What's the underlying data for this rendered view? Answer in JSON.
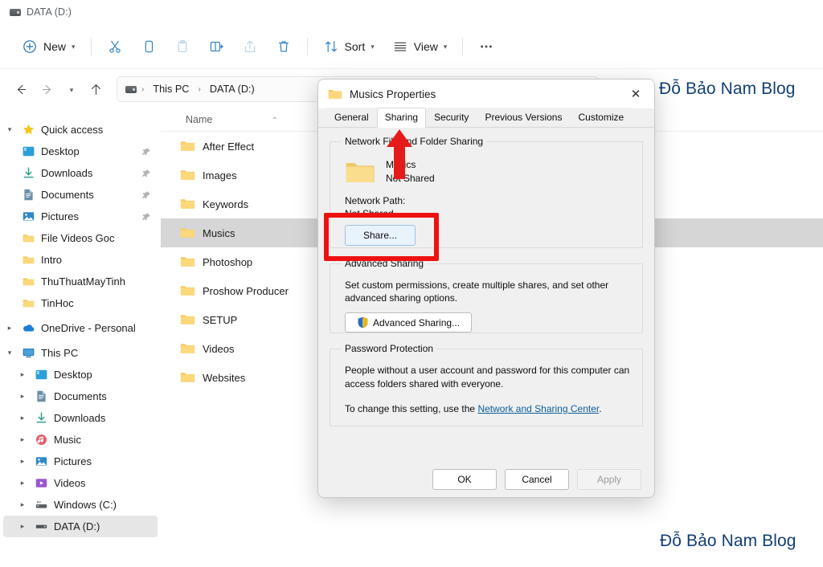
{
  "window": {
    "title": "DATA (D:)",
    "drive_icon": "drive-icon"
  },
  "toolbar": {
    "new_label": "New",
    "sort_label": "Sort",
    "view_label": "View",
    "more_label": "•••",
    "icons": {
      "new": "plus-circle-icon",
      "cut": "scissors-icon",
      "copy": "copy-icon",
      "paste": "paste-icon",
      "rename": "rename-icon",
      "share": "share-icon",
      "delete": "trash-icon",
      "sort": "sort-arrows-icon",
      "view": "view-lines-icon",
      "more": "ellipsis-icon"
    }
  },
  "address_bar": {
    "back_icon": "arrow-left-icon",
    "forward_icon": "arrow-right-icon",
    "recent_icon": "chevron-down-icon",
    "up_icon": "arrow-up-icon",
    "crumbs": [
      "This PC",
      "DATA (D:)"
    ],
    "separator": "›"
  },
  "sidebar": {
    "groups": [
      {
        "label": "Quick access",
        "icon": "star-icon",
        "expander": "chevron-down",
        "items": [
          {
            "label": "Desktop",
            "icon": "desktop-icon",
            "pinned": true
          },
          {
            "label": "Downloads",
            "icon": "download-icon",
            "pinned": true
          },
          {
            "label": "Documents",
            "icon": "document-icon",
            "pinned": true
          },
          {
            "label": "Pictures",
            "icon": "pictures-icon",
            "pinned": true
          },
          {
            "label": "File Videos Goc",
            "icon": "folder-icon",
            "pinned": false
          },
          {
            "label": "Intro",
            "icon": "folder-icon",
            "pinned": false
          },
          {
            "label": "ThuThuatMayTinh",
            "icon": "folder-icon",
            "pinned": false
          },
          {
            "label": "TinHoc",
            "icon": "folder-icon",
            "pinned": false
          }
        ]
      },
      {
        "label": "OneDrive - Personal",
        "icon": "cloud-icon",
        "expander": "chevron-right",
        "items": []
      },
      {
        "label": "This PC",
        "icon": "pc-icon",
        "expander": "chevron-down",
        "items": [
          {
            "label": "Desktop",
            "icon": "desktop-icon",
            "expander": "chevron-right"
          },
          {
            "label": "Documents",
            "icon": "document-icon",
            "expander": "chevron-right"
          },
          {
            "label": "Downloads",
            "icon": "download-icon",
            "expander": "chevron-right"
          },
          {
            "label": "Music",
            "icon": "music-icon",
            "expander": "chevron-right"
          },
          {
            "label": "Pictures",
            "icon": "pictures-icon",
            "expander": "chevron-right"
          },
          {
            "label": "Videos",
            "icon": "videos-icon",
            "expander": "chevron-right"
          },
          {
            "label": "Windows (C:)",
            "icon": "sysdrive-icon",
            "expander": "chevron-right"
          },
          {
            "label": "DATA (D:)",
            "icon": "drive-icon",
            "expander": "chevron-right",
            "selected": true
          }
        ]
      }
    ]
  },
  "file_list": {
    "column_header": "Name",
    "sort_caret": "⌃",
    "rows": [
      {
        "name": "After Effect",
        "icon": "folder-icon"
      },
      {
        "name": "Images",
        "icon": "folder-icon"
      },
      {
        "name": "Keywords",
        "icon": "folder-icon"
      },
      {
        "name": "Musics",
        "icon": "folder-icon",
        "selected": true
      },
      {
        "name": "Photoshop",
        "icon": "folder-icon"
      },
      {
        "name": "Proshow Producer",
        "icon": "folder-icon"
      },
      {
        "name": "SETUP",
        "icon": "folder-icon"
      },
      {
        "name": "Videos",
        "icon": "folder-icon"
      },
      {
        "name": "Websites",
        "icon": "folder-icon"
      }
    ]
  },
  "dialog": {
    "title": "Musics Properties",
    "close_icon": "close-icon",
    "tabs": [
      {
        "label": "General",
        "active": false
      },
      {
        "label": "Sharing",
        "active": true
      },
      {
        "label": "Security",
        "active": false
      },
      {
        "label": "Previous Versions",
        "active": false
      },
      {
        "label": "Customize",
        "active": false
      }
    ],
    "network_sharing": {
      "legend": "Network File and Folder Sharing",
      "folder_name": "Musics",
      "share_state": "Not Shared",
      "network_path_label": "Network Path:",
      "network_path_value": "Not Shared",
      "share_button": "Share..."
    },
    "advanced_sharing": {
      "legend": "Advanced Sharing",
      "description": "Set custom permissions, create multiple shares, and set other advanced sharing options.",
      "button": "Advanced Sharing...",
      "button_icon": "uac-shield-icon"
    },
    "password_protection": {
      "legend": "Password Protection",
      "paragraph1": "People without a user account and password for this computer can access folders shared with everyone.",
      "paragraph2_prefix": "To change this setting, use the ",
      "link": "Network and Sharing Center",
      "paragraph2_suffix": "."
    },
    "footer": {
      "ok": "OK",
      "cancel": "Cancel",
      "apply": "Apply",
      "apply_disabled": true
    }
  },
  "annotations": {
    "highlight_color": "#ee1111",
    "arrow_name": "red-up-arrow-pointing-to-sharing-tab",
    "box_name": "red-highlight-box-around-share-button"
  },
  "watermark": {
    "text": "Đỗ Bảo Nam Blog",
    "color": "#123f73"
  }
}
